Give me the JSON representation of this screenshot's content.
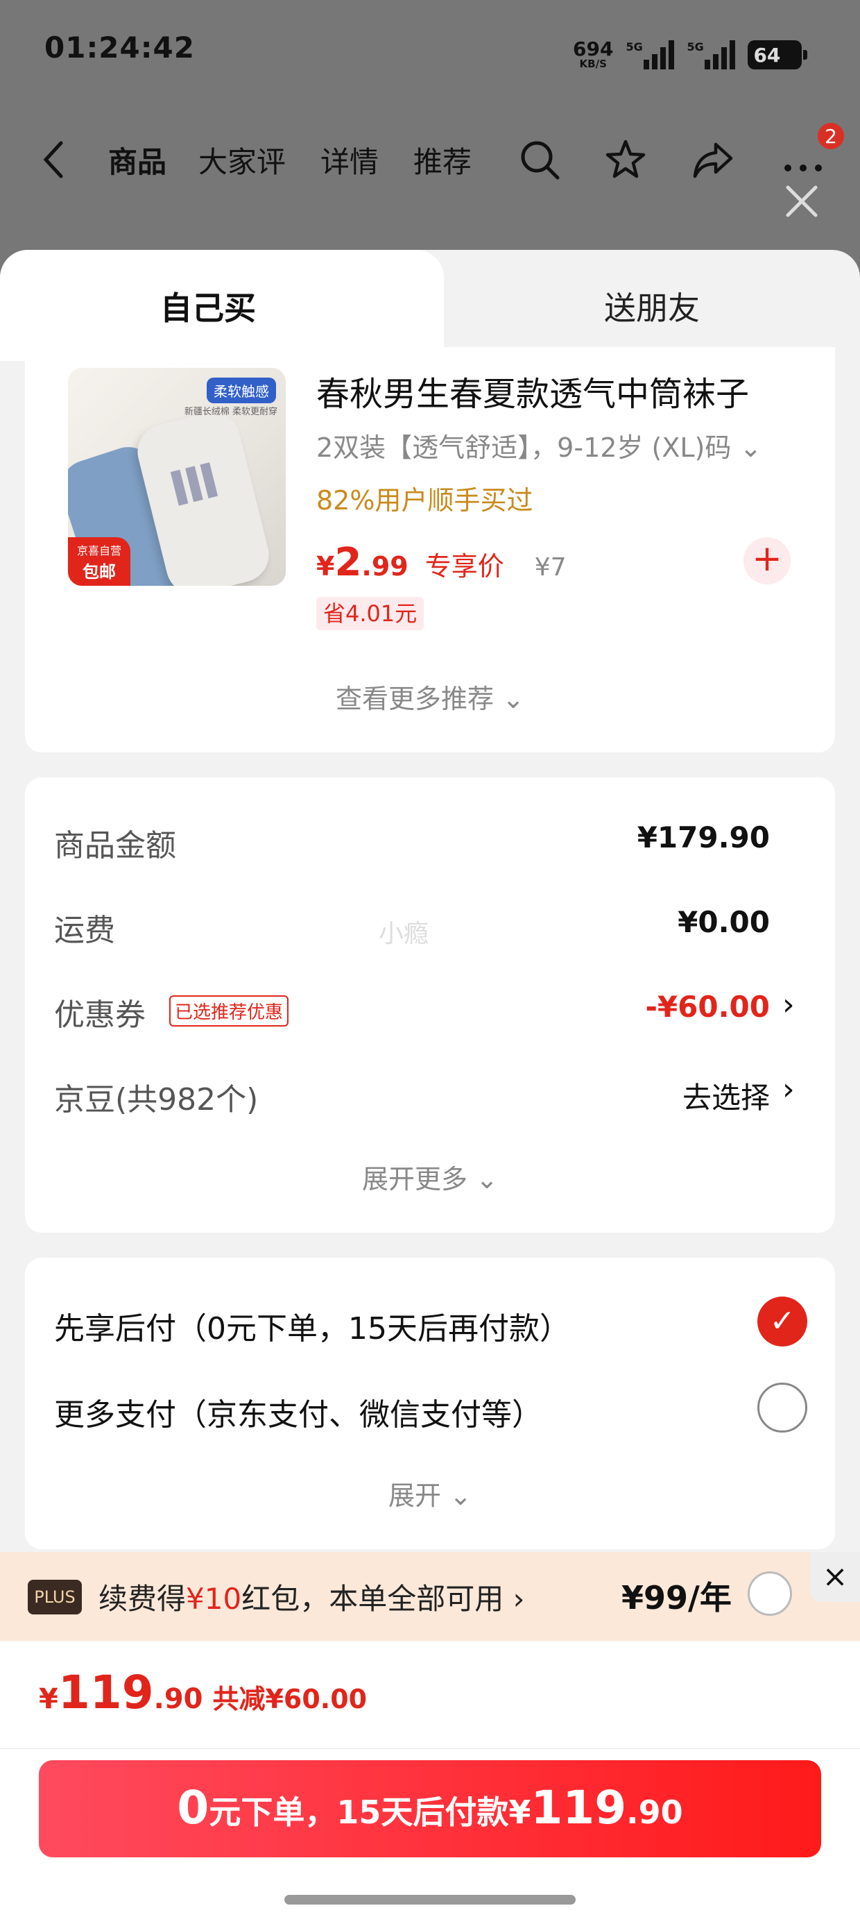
{
  "status": {
    "time": "01:24:42",
    "net_speed": "694",
    "net_unit": "KB/S",
    "sig1_label": "5G",
    "sig2_label": "5G",
    "battery": "64"
  },
  "nav": {
    "tabs": [
      "商品",
      "大家评",
      "详情",
      "推荐"
    ],
    "badge": "2"
  },
  "sheet": {
    "tab_self": "自己买",
    "tab_friend": "送朋友"
  },
  "product": {
    "image_tag": "柔软触感",
    "image_sub": "新疆长绒棉 柔软更耐穿",
    "jd_tag_top": "京喜自营",
    "jd_tag_bottom": "包邮",
    "title": "春秋男生春夏款透气中筒袜子",
    "spec": "2双装【透气舒适】，9-12岁 (XL)码",
    "bought": "82%用户顺手买过",
    "price_symbol": "¥",
    "price_int": "2",
    "price_dec": ".99",
    "price_tag": "专享价",
    "price_orig": "¥7",
    "save": "省4.01元",
    "add": "+"
  },
  "see_more": "查看更多推荐",
  "summary": {
    "rows": [
      {
        "label": "商品金额",
        "value": "¥179.90"
      },
      {
        "label": "运费",
        "value": "¥0.00"
      },
      {
        "label": "优惠券",
        "value": "-¥60.00",
        "tag": "已选推荐优惠"
      },
      {
        "label": "京豆(共982个)",
        "value": "去选择"
      }
    ],
    "watermark": "小瘾",
    "expand": "展开更多"
  },
  "payment": {
    "options": [
      {
        "label": "先享后付（0元下单，15天后再付款）",
        "selected": true
      },
      {
        "label": "更多支付（京东支付、微信支付等）",
        "selected": false
      }
    ],
    "expand": "展开"
  },
  "plus": {
    "logo": "PLUS",
    "text_pre": "续费得",
    "text_red": "¥10",
    "text_post": "红包，本单全部可用",
    "price": "¥99/年"
  },
  "footer": {
    "total_symbol": "¥",
    "total_int": "119",
    "total_dec": ".90",
    "reduce": "共减¥60.00",
    "submit_a": "0",
    "submit_b": "元下单，15天后付款¥",
    "submit_c": "119",
    "submit_d": ".90"
  },
  "colors": {
    "accent": "#e1251b",
    "plus_bg": "#fbe8d9"
  }
}
